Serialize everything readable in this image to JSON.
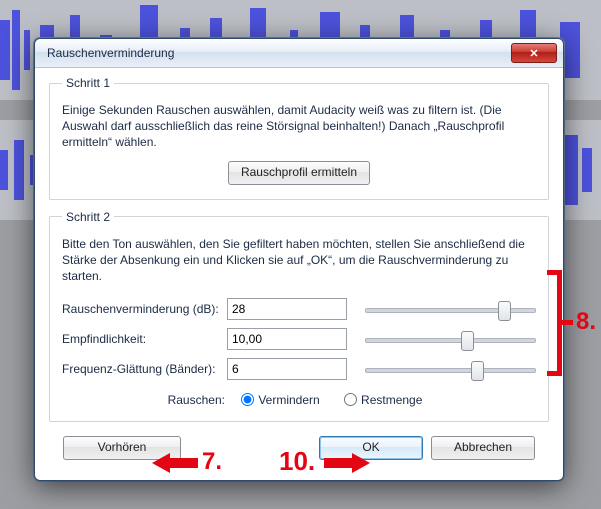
{
  "dialog": {
    "title": "Rauschenverminderung"
  },
  "step1": {
    "legend": "Schritt 1",
    "text": "Einige Sekunden Rauschen auswählen, damit Audacity weiß was zu filtern ist. (Die Auswahl darf ausschließlich das reine Störsignal beinhalten!) Danach „Rauschprofil ermitteln“ wählen.",
    "profile_btn": "Rauschprofil ermitteln"
  },
  "step2": {
    "legend": "Schritt 2",
    "text": "Bitte den Ton auswählen, den Sie gefiltert haben möchten, stellen Sie anschließend die Stärke der Absenkung ein und Klicken sie auf „OK“, um die Rauschverminderung zu starten.",
    "rows": [
      {
        "label": "Rauschenverminderung (dB):",
        "value": "28"
      },
      {
        "label": "Empfindlichkeit:",
        "value": "10,00"
      },
      {
        "label": "Frequenz-Glättung (Bänder):",
        "value": "6"
      }
    ],
    "noise_label": "Rauschen:",
    "radio_reduce": "Vermindern",
    "radio_residual": "Restmenge"
  },
  "footer": {
    "preview": "Vorhören",
    "ok": "OK",
    "cancel": "Abbrechen"
  },
  "annotations": {
    "seven": "7.",
    "eight": "8.",
    "ten": "10."
  }
}
